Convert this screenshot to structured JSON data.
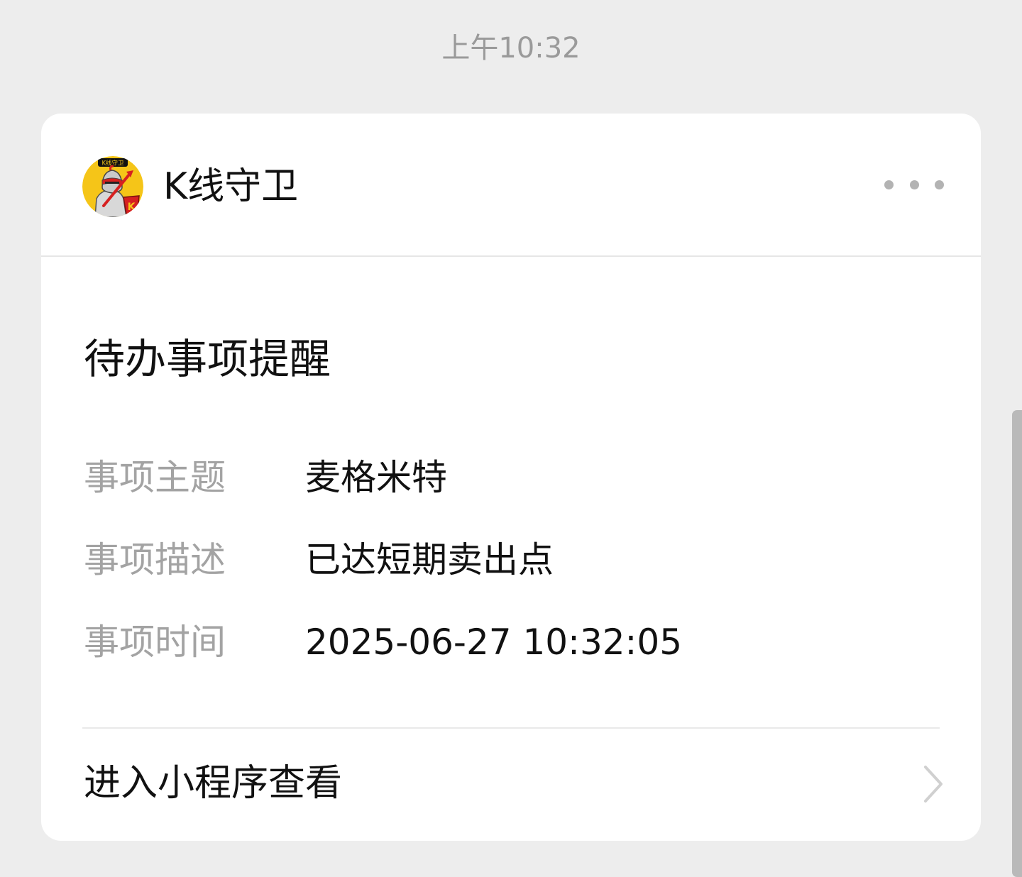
{
  "timestamp": "上午10:32",
  "card": {
    "sender_name": "K线守卫",
    "avatar_icon": "knight-k-line-guard-avatar-icon",
    "avatar_text": "K线守卫",
    "avatar_badge": "K",
    "more_icon": "more-dots-icon",
    "title": "待办事项提醒",
    "fields": [
      {
        "label": "事项主题",
        "value": "麦格米特"
      },
      {
        "label": "事项描述",
        "value": "已达短期卖出点"
      },
      {
        "label": "事项时间",
        "value": "2025-06-27 10:32:05"
      }
    ],
    "footer_label": "进入小程序查看",
    "footer_icon": "chevron-right-icon"
  },
  "colors": {
    "background": "#ededed",
    "card": "#ffffff",
    "label_gray": "#a3a3a3",
    "text": "#111111",
    "avatar_yellow": "#f5c518",
    "avatar_red": "#d62020"
  }
}
